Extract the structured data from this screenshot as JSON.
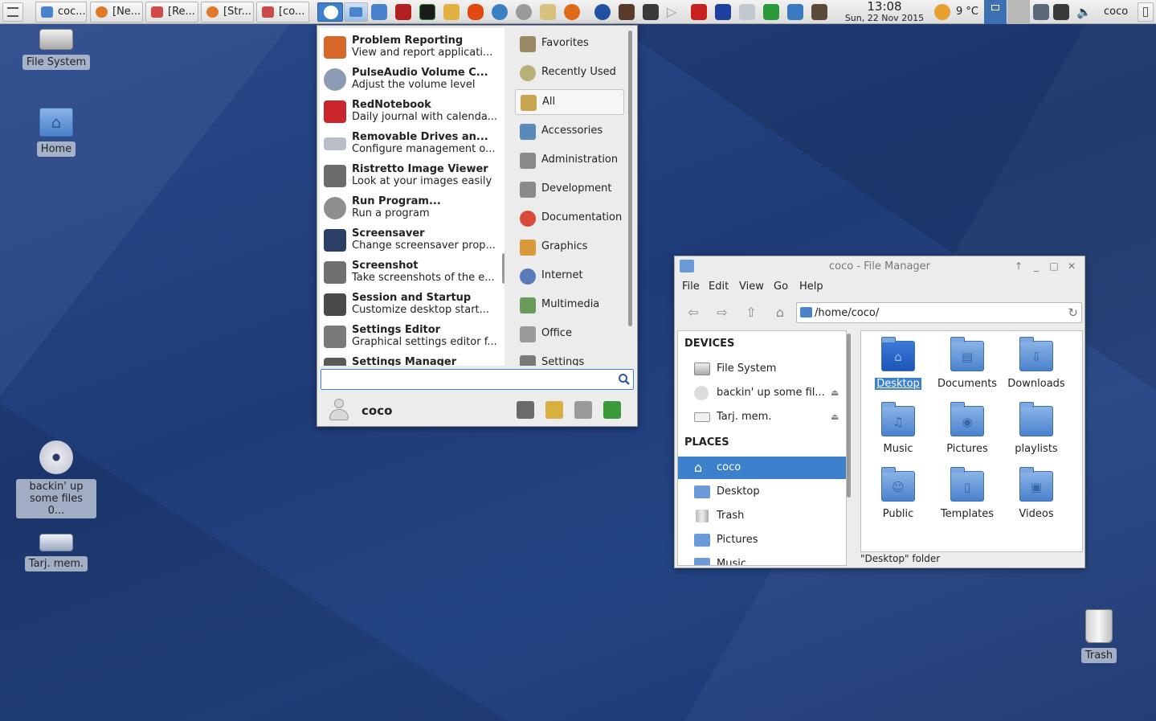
{
  "panel": {
    "tasks": [
      "coc...",
      "[Ne...",
      "[Re...",
      "[Str...",
      "[co..."
    ],
    "clock": {
      "time": "13:08",
      "date": "Sun, 22 Nov 2015"
    },
    "weather": "9 °C",
    "user": "coco"
  },
  "desktop": {
    "filesystem": "File System",
    "home": "Home",
    "backup_line1": "backin' up",
    "backup_line2": "some files 0...",
    "card": "Tarj. mem.",
    "trash": "Trash"
  },
  "menu": {
    "apps": [
      {
        "name": "Problem Reporting",
        "desc": "View and report applicati...",
        "color": "#d8672a"
      },
      {
        "name": "PulseAudio Volume C...",
        "desc": "Adjust the volume level",
        "color": "#8c9bb3"
      },
      {
        "name": "RedNotebook",
        "desc": "Daily journal with calenda...",
        "color": "#c8262a"
      },
      {
        "name": "Removable Drives an...",
        "desc": "Configure management o...",
        "color": "#b9bfc8"
      },
      {
        "name": "Ristretto Image Viewer",
        "desc": "Look at your images easily",
        "color": "#6b6b6b"
      },
      {
        "name": "Run Program...",
        "desc": "Run a program",
        "color": "#8f8f8f"
      },
      {
        "name": "Screensaver",
        "desc": "Change screensaver prop...",
        "color": "#2b3e66"
      },
      {
        "name": "Screenshot",
        "desc": "Take screenshots of the e...",
        "color": "#707070"
      },
      {
        "name": "Session and Startup",
        "desc": "Customize desktop start...",
        "color": "#4a4a4a"
      },
      {
        "name": "Settings Editor",
        "desc": "Graphical settings editor f...",
        "color": "#7a7a7a"
      },
      {
        "name": "Settings Manager",
        "desc": "",
        "color": "#5a5a5a"
      }
    ],
    "categories": [
      {
        "label": "Favorites",
        "color": "#9a8a64"
      },
      {
        "label": "Recently Used",
        "color": "#b8b07a"
      },
      {
        "label": "All",
        "color": "#c8a450"
      },
      {
        "label": "Accessories",
        "color": "#5a8ab8"
      },
      {
        "label": "Administration",
        "color": "#8a8a8a"
      },
      {
        "label": "Development",
        "color": "#8a8a8a"
      },
      {
        "label": "Documentation",
        "color": "#d84a3a"
      },
      {
        "label": "Graphics",
        "color": "#d89a3a"
      },
      {
        "label": "Internet",
        "color": "#5a7ab8"
      },
      {
        "label": "Multimedia",
        "color": "#6a9a5a"
      },
      {
        "label": "Office",
        "color": "#9a9a9a"
      },
      {
        "label": "Settings",
        "color": "#7a7a7a"
      }
    ],
    "search_value": "",
    "user": "coco"
  },
  "filemanager": {
    "title": "coco - File Manager",
    "menus": [
      "File",
      "Edit",
      "View",
      "Go",
      "Help"
    ],
    "location": "/home/coco/",
    "devices_header": "DEVICES",
    "devices": [
      "File System",
      "backin' up some fil...",
      "Tarj. mem."
    ],
    "places_header": "PLACES",
    "places": [
      "coco",
      "Desktop",
      "Trash",
      "Pictures",
      "Music"
    ],
    "folders": [
      {
        "name": "Desktop",
        "glyph": "⌂"
      },
      {
        "name": "Documents",
        "glyph": "▤"
      },
      {
        "name": "Downloads",
        "glyph": "⇩"
      },
      {
        "name": "Music",
        "glyph": "♫"
      },
      {
        "name": "Pictures",
        "glyph": "◉"
      },
      {
        "name": "playlists",
        "glyph": ""
      },
      {
        "name": "Public",
        "glyph": "☺"
      },
      {
        "name": "Templates",
        "glyph": "▯"
      },
      {
        "name": "Videos",
        "glyph": "▣"
      }
    ],
    "status": "\"Desktop\" folder"
  }
}
